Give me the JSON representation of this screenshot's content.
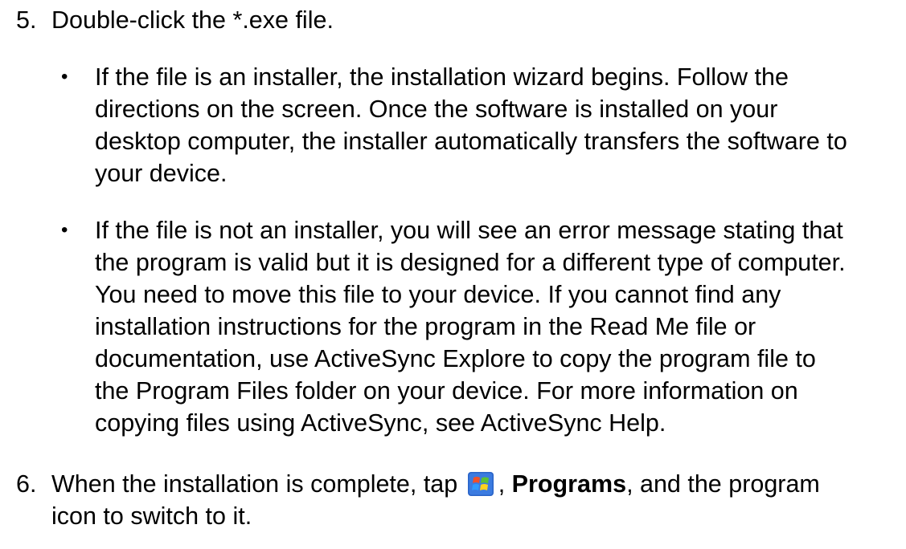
{
  "steps": [
    {
      "number": "5.",
      "text": "Double-click the *.exe file.",
      "bullets": [
        {
          "lines": [
            "If the file is an installer, the installation wizard begins. Follow the",
            "directions on the screen. Once the software is installed on your",
            "desktop computer, the installer automatically transfers the software to",
            "your device."
          ]
        },
        {
          "lines": [
            "If the file is not an installer, you will see an error message stating that",
            "the program is valid but it is designed for a different type of computer.",
            "You need to move this file to your device. If you cannot find any",
            "installation instructions for the program in the Read Me file or",
            "documentation, use ActiveSync Explore to copy the program file to",
            "the Program Files folder on your device. For more information on",
            "copying files using ActiveSync, see ActiveSync Help."
          ]
        }
      ]
    },
    {
      "number": "6.",
      "line1_before": "When the installation is complete, tap",
      "line1_sep": ",",
      "line1_bold": "Programs",
      "line1_after": ", and the program",
      "line2": "icon to switch to it."
    }
  ],
  "bullet_glyph": "•",
  "icon": {
    "name": "windows-start-icon"
  }
}
